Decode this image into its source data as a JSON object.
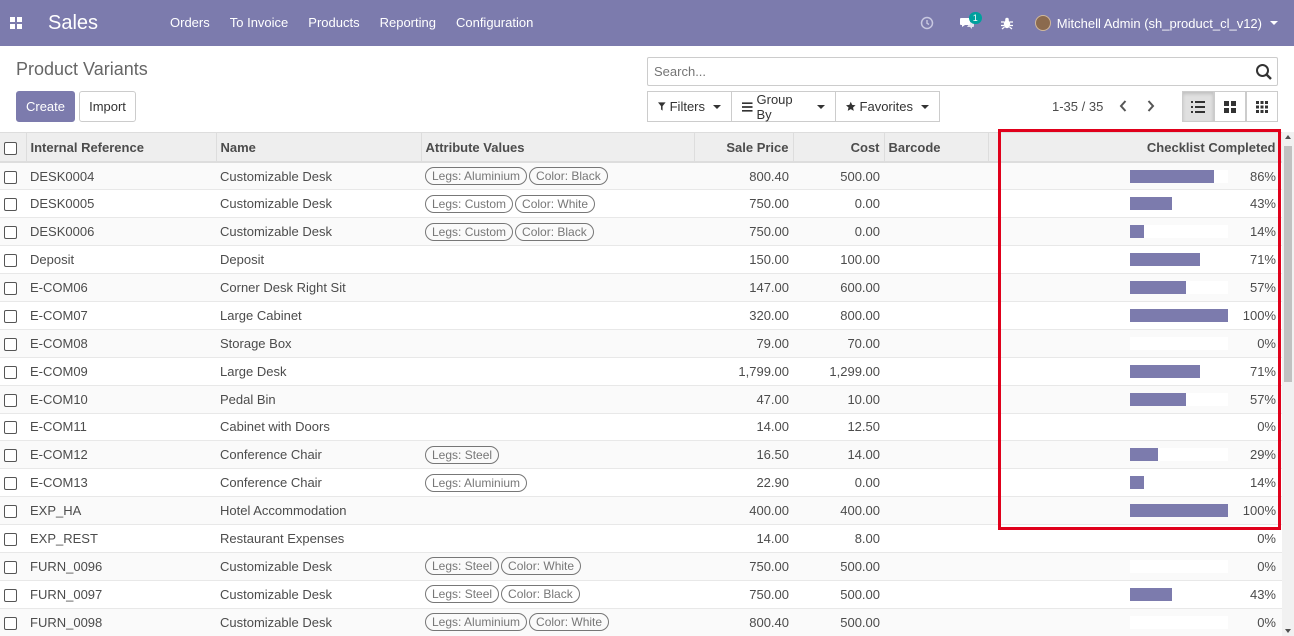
{
  "navbar": {
    "brand": "Sales",
    "menu": [
      "Orders",
      "To Invoice",
      "Products",
      "Reporting",
      "Configuration"
    ],
    "chat_badge": "1",
    "user": "Mitchell Admin (sh_product_cl_v12)"
  },
  "control": {
    "breadcrumb": "Product Variants",
    "create_label": "Create",
    "import_label": "Import",
    "search_placeholder": "Search...",
    "filters_label": "Filters",
    "groupby_label": "Group By",
    "favorites_label": "Favorites",
    "pager": "1-35 / 35"
  },
  "table": {
    "headers": [
      "Internal Reference",
      "Name",
      "Attribute Values",
      "Sale Price",
      "Cost",
      "Barcode",
      "Checklist Completed"
    ],
    "rows": [
      {
        "ref": "DESK0004",
        "name": "Customizable Desk",
        "tags": [
          "Legs: Aluminium",
          "Color: Black"
        ],
        "price": "800.40",
        "cost": "500.00",
        "pct": "86%",
        "progress": 0.86
      },
      {
        "ref": "DESK0005",
        "name": "Customizable Desk",
        "tags": [
          "Legs: Custom",
          "Color: White"
        ],
        "price": "750.00",
        "cost": "0.00",
        "pct": "43%",
        "progress": 0.43
      },
      {
        "ref": "DESK0006",
        "name": "Customizable Desk",
        "tags": [
          "Legs: Custom",
          "Color: Black"
        ],
        "price": "750.00",
        "cost": "0.00",
        "pct": "14%",
        "progress": 0.14
      },
      {
        "ref": "Deposit",
        "name": "Deposit",
        "tags": [],
        "price": "150.00",
        "cost": "100.00",
        "pct": "71%",
        "progress": 0.71
      },
      {
        "ref": "E-COM06",
        "name": "Corner Desk Right Sit",
        "tags": [],
        "price": "147.00",
        "cost": "600.00",
        "pct": "57%",
        "progress": 0.57
      },
      {
        "ref": "E-COM07",
        "name": "Large Cabinet",
        "tags": [],
        "price": "320.00",
        "cost": "800.00",
        "pct": "100%",
        "progress": 1.0
      },
      {
        "ref": "E-COM08",
        "name": "Storage Box",
        "tags": [],
        "price": "79.00",
        "cost": "70.00",
        "pct": "0%",
        "progress": 0
      },
      {
        "ref": "E-COM09",
        "name": "Large Desk",
        "tags": [],
        "price": "1,799.00",
        "cost": "1,299.00",
        "pct": "71%",
        "progress": 0.71
      },
      {
        "ref": "E-COM10",
        "name": "Pedal Bin",
        "tags": [],
        "price": "47.00",
        "cost": "10.00",
        "pct": "57%",
        "progress": 0.57
      },
      {
        "ref": "E-COM11",
        "name": "Cabinet with Doors",
        "tags": [],
        "price": "14.00",
        "cost": "12.50",
        "pct": "0%",
        "progress": 0
      },
      {
        "ref": "E-COM12",
        "name": "Conference Chair",
        "tags": [
          "Legs: Steel"
        ],
        "price": "16.50",
        "cost": "14.00",
        "pct": "29%",
        "progress": 0.29
      },
      {
        "ref": "E-COM13",
        "name": "Conference Chair",
        "tags": [
          "Legs: Aluminium"
        ],
        "price": "22.90",
        "cost": "0.00",
        "pct": "14%",
        "progress": 0.14
      },
      {
        "ref": "EXP_HA",
        "name": "Hotel Accommodation",
        "tags": [],
        "price": "400.00",
        "cost": "400.00",
        "pct": "100%",
        "progress": 1.0
      },
      {
        "ref": "EXP_REST",
        "name": "Restaurant Expenses",
        "tags": [],
        "price": "14.00",
        "cost": "8.00",
        "pct": "0%",
        "progress": 0
      },
      {
        "ref": "FURN_0096",
        "name": "Customizable Desk",
        "tags": [
          "Legs: Steel",
          "Color: White"
        ],
        "price": "750.00",
        "cost": "500.00",
        "pct": "0%",
        "progress": 0
      },
      {
        "ref": "FURN_0097",
        "name": "Customizable Desk",
        "tags": [
          "Legs: Steel",
          "Color: Black"
        ],
        "price": "750.00",
        "cost": "500.00",
        "pct": "43%",
        "progress": 0.43
      },
      {
        "ref": "FURN_0098",
        "name": "Customizable Desk",
        "tags": [
          "Legs: Aluminium",
          "Color: White"
        ],
        "price": "800.40",
        "cost": "500.00",
        "pct": "0%",
        "progress": 0
      }
    ]
  },
  "colors": {
    "brand": "#7c7bad",
    "highlight": "#e0001b"
  }
}
